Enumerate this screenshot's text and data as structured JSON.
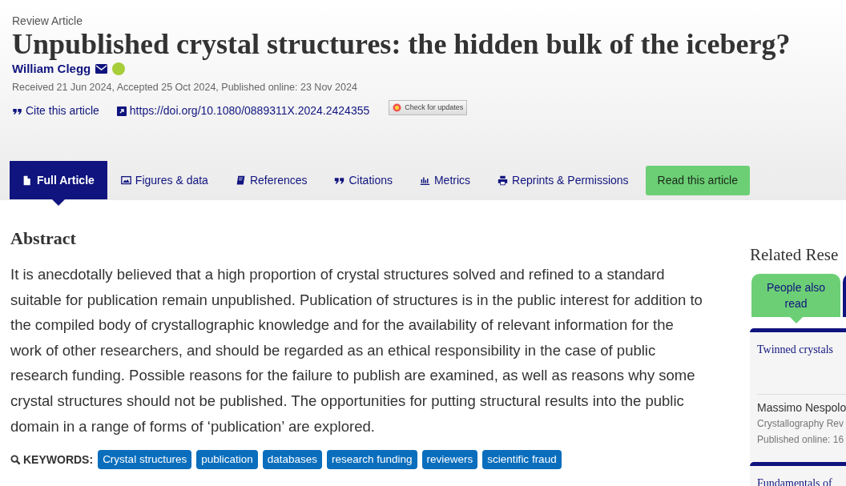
{
  "article": {
    "type": "Review Article",
    "title": "Unpublished crystal structures: the hidden bulk of the iceberg?",
    "author": "William Clegg",
    "dates": "Received 21 Jun 2024, Accepted 25 Oct 2024, Published online: 23 Nov 2024",
    "cite": "Cite this article",
    "doi": "https://doi.org/10.1080/0889311X.2024.2424355",
    "updates": "Check for updates"
  },
  "tabs": [
    {
      "label": "Full Article",
      "selected": true
    },
    {
      "label": "Figures & data",
      "selected": false
    },
    {
      "label": "References",
      "selected": false
    },
    {
      "label": "Citations",
      "selected": false
    },
    {
      "label": "Metrics",
      "selected": false
    },
    {
      "label": "Reprints & Permissions",
      "selected": false
    }
  ],
  "read_button": "Read this article",
  "abstract": {
    "heading": "Abstract",
    "text": "It is anecdotally believed that a high proportion of crystal structures solved and refined to a standard suitable for publication remain unpublished. Publication of structures is in the public interest for addition to the compiled body of crystallographic knowledge and for the availability of relevant information for the work of other researchers, and should be regarded as an ethical responsibility in the case of public research funding. Possible reasons for the failure to publish are examined, as well as reasons why some crystal structures should not be published. The opportunities for putting structural results into the public domain in a range of forms of ‘publication’ are explored."
  },
  "keywords": {
    "label": "KEYWORDS:",
    "items": [
      "Crystal structures",
      "publication",
      "databases",
      "research funding",
      "reviewers",
      "scientific fraud"
    ]
  },
  "related": {
    "heading": "Related Rese",
    "tabs": [
      {
        "label": "People also read",
        "selected": true
      },
      {
        "selected": false
      }
    ],
    "items": [
      {
        "title": "Twinned crystals",
        "author": "Massimo Nespolo",
        "journal": "Crystallography Rev",
        "published": "Published online: 16"
      },
      {
        "title": "Fundamentals of"
      }
    ]
  }
}
